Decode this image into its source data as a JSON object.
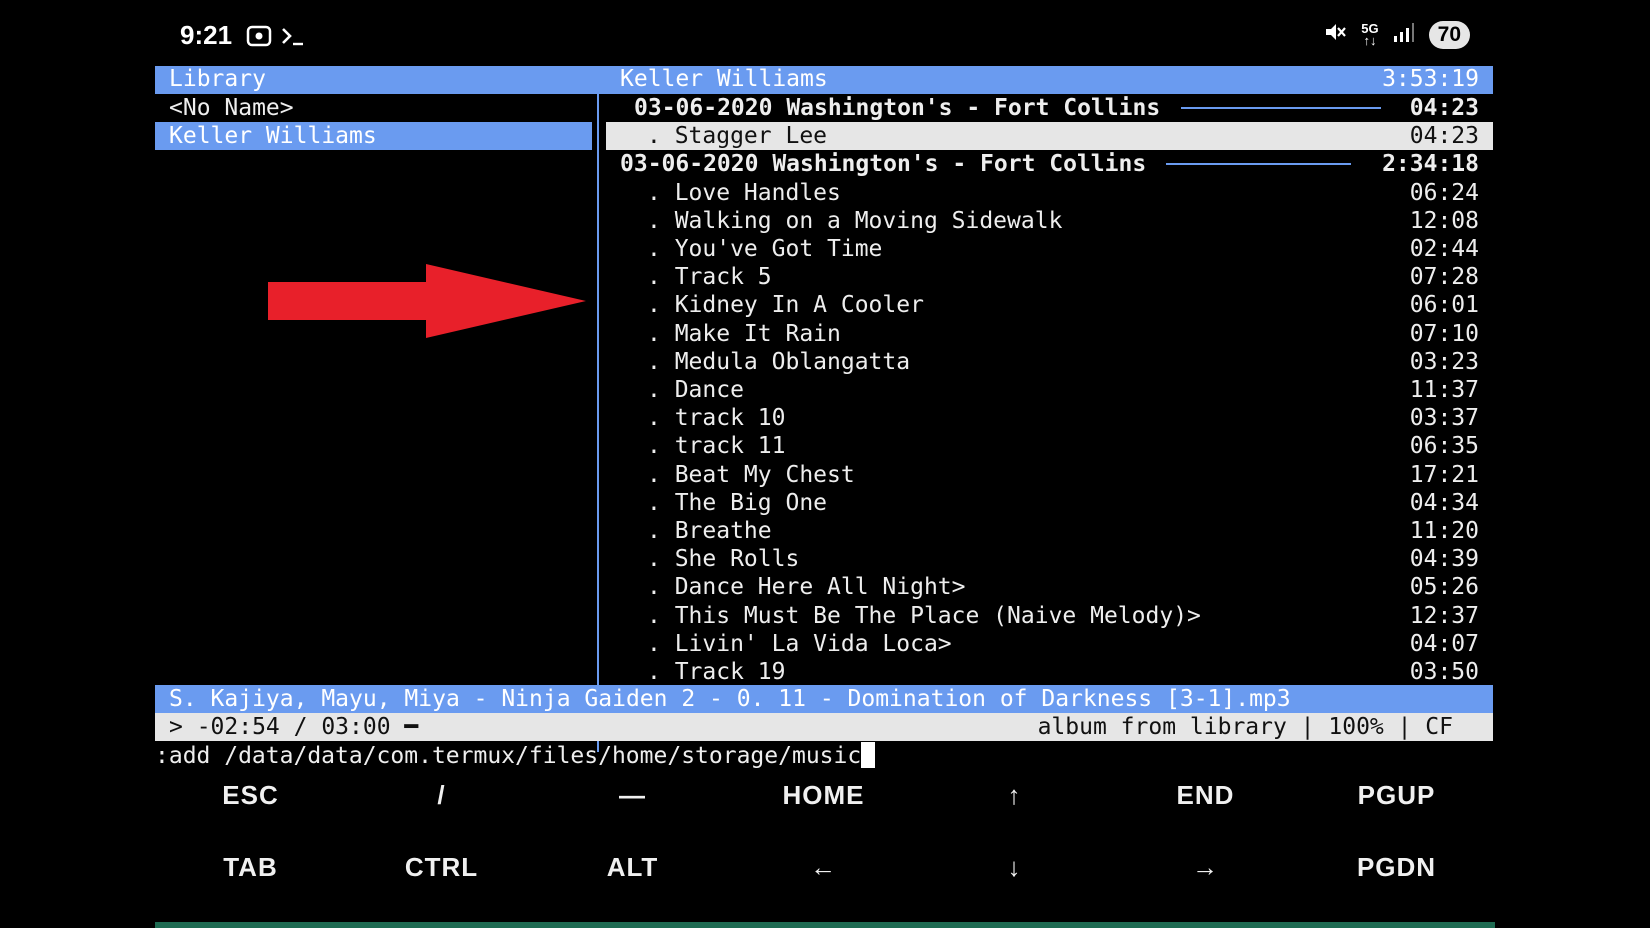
{
  "status_bar": {
    "time": "9:21",
    "icons": [
      "screenshot-icon",
      "terminal-prompt-icon"
    ],
    "right_icons": [
      "mute-icon",
      "5g-icon",
      "signal-icon"
    ],
    "battery": "70"
  },
  "library_pane": {
    "title": "Library",
    "items": [
      {
        "label": "<No Name>",
        "selected": false
      },
      {
        "label": "Keller Williams",
        "selected": true
      }
    ]
  },
  "tracks_pane": {
    "title": "Keller Williams",
    "total_duration": "3:53:19",
    "rows": [
      {
        "type": "album",
        "label": "03-06-2020 Washington's - Fort Collins",
        "duration": "04:23",
        "indent": true
      },
      {
        "type": "track",
        "label": ". Stagger Lee",
        "duration": "04:23",
        "current": true
      },
      {
        "type": "album",
        "label": "03-06-2020 Washington's - Fort Collins",
        "duration": "2:34:18",
        "indent": false
      },
      {
        "type": "track",
        "label": ". Love Handles",
        "duration": "06:24"
      },
      {
        "type": "track",
        "label": ". Walking on a Moving Sidewalk",
        "duration": "12:08"
      },
      {
        "type": "track",
        "label": ". You've Got Time",
        "duration": "02:44"
      },
      {
        "type": "track",
        "label": ". Track 5",
        "duration": "07:28"
      },
      {
        "type": "track",
        "label": ". Kidney In A Cooler",
        "duration": "06:01"
      },
      {
        "type": "track",
        "label": ". Make It Rain",
        "duration": "07:10"
      },
      {
        "type": "track",
        "label": ". Medula Oblangatta",
        "duration": "03:23"
      },
      {
        "type": "track",
        "label": ". Dance",
        "duration": "11:37"
      },
      {
        "type": "track",
        "label": ". track 10",
        "duration": "03:37"
      },
      {
        "type": "track",
        "label": ". track 11",
        "duration": "06:35"
      },
      {
        "type": "track",
        "label": ". Beat My Chest",
        "duration": "17:21"
      },
      {
        "type": "track",
        "label": ". The Big One",
        "duration": "04:34"
      },
      {
        "type": "track",
        "label": ". Breathe",
        "duration": "11:20"
      },
      {
        "type": "track",
        "label": ". She Rolls",
        "duration": "04:39"
      },
      {
        "type": "track",
        "label": ". Dance Here All Night>",
        "duration": "05:26"
      },
      {
        "type": "track",
        "label": ". This Must Be The Place (Naive Melody)>",
        "duration": "12:37"
      },
      {
        "type": "track",
        "label": ". Livin' La Vida Loca>",
        "duration": "04:07"
      },
      {
        "type": "track",
        "label": ". Track 19",
        "duration": "03:50"
      }
    ]
  },
  "now_playing": "S. Kajiya, Mayu, Miya - Ninja Gaiden 2 - 0. 11 - Domination of Darkness [3-1].mp3",
  "status_line": {
    "left": "> -02:54 / 03:00 ━",
    "right": "album from library | 100% | CF"
  },
  "command_line": ":add /data/data/com.termux/files/home/storage/music",
  "extra_keys": {
    "row1": [
      "ESC",
      "/",
      "—",
      "HOME",
      "↑",
      "END",
      "PGUP"
    ],
    "row2": [
      "TAB",
      "CTRL",
      "ALT",
      "←",
      "↓",
      "→",
      "PGDN"
    ]
  },
  "colors": {
    "accent": "#6a9bf0",
    "highlight": "#e6e6e6",
    "arrow": "#e8202a",
    "bottom_bar": "#1e6b52"
  }
}
